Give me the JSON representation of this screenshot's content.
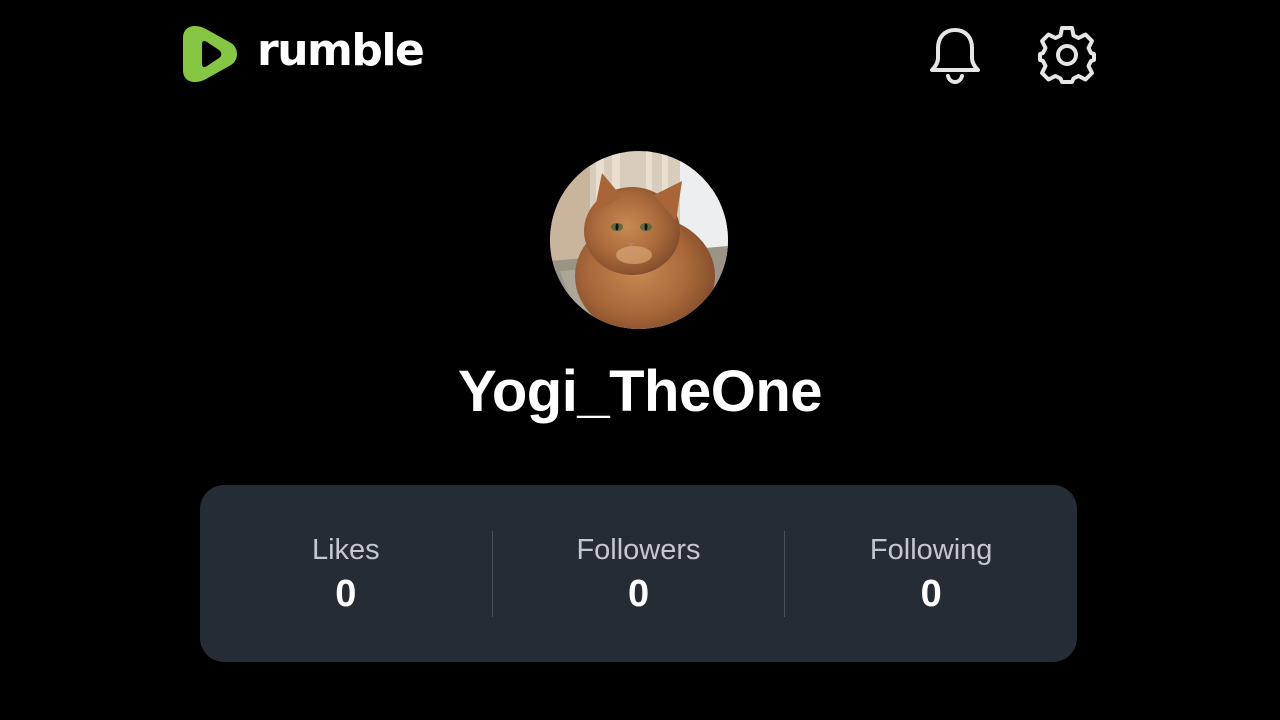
{
  "header": {
    "logo_text": "rumble",
    "brand_color": "#85c742",
    "notifications_icon": "bell-icon",
    "settings_icon": "gear-icon"
  },
  "profile": {
    "avatar": "cat-avatar",
    "username": "Yogi_TheOne"
  },
  "stats": [
    {
      "label": "Likes",
      "value": "0"
    },
    {
      "label": "Followers",
      "value": "0"
    },
    {
      "label": "Following",
      "value": "0"
    }
  ],
  "colors": {
    "background": "#000000",
    "card": "#252c34",
    "label": "#c4c8ce",
    "text": "#ffffff"
  }
}
